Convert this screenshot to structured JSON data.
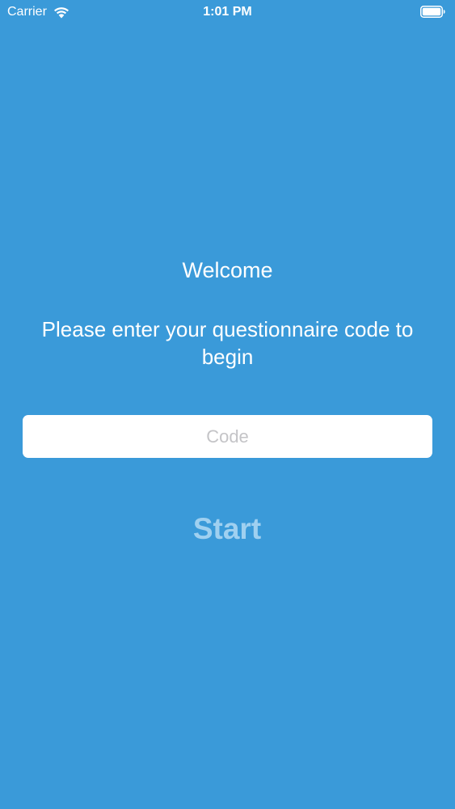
{
  "status_bar": {
    "carrier": "Carrier",
    "time": "1:01 PM",
    "wifi_icon": "wifi-icon",
    "battery_icon": "battery-full-icon"
  },
  "main": {
    "welcome": "Welcome",
    "instructions": "Please enter your questionnaire code to begin",
    "code_input": {
      "placeholder": "Code",
      "value": ""
    },
    "start_button_label": "Start"
  },
  "colors": {
    "background": "#3a9ad9",
    "text": "#ffffff",
    "start_button_disabled": "#9fd0f0",
    "input_background": "#ffffff",
    "placeholder": "#c4c4c7"
  }
}
